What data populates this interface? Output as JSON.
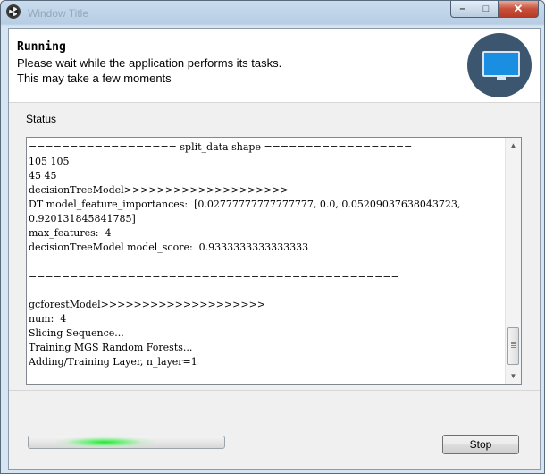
{
  "window": {
    "title": "Window Title",
    "controls": {
      "minimize": "–",
      "maximize": "□",
      "close": "✕"
    }
  },
  "header": {
    "title": "Running",
    "line1": "Please wait while the application performs its tasks.",
    "line2": "This may take a few moments",
    "icon": "monitor-icon",
    "badge_color": "#3d5670"
  },
  "status": {
    "label": "Status",
    "log_lines": [
      "================== split_data shape ==================",
      "105 105",
      "45 45",
      "decisionTreeModel>>>>>>>>>>>>>>>>>>>>",
      "DT model_feature_importances:  [0.02777777777777777, 0.0, 0.05209037638043723,",
      "0.920131845841785]",
      "max_features:  4",
      "decisionTreeModel model_score:  0.9333333333333333",
      "",
      "=============================================",
      "",
      "gcforestModel>>>>>>>>>>>>>>>>>>>>",
      "num:  4",
      "Slicing Sequence...",
      "Training MGS Random Forests...",
      "Adding/Training Layer, n_layer=1"
    ],
    "scroll_up": "▲",
    "scroll_down": "▼"
  },
  "footer": {
    "progress": "indeterminate",
    "progress_color": "#27e23a",
    "stop_label": "Stop"
  }
}
